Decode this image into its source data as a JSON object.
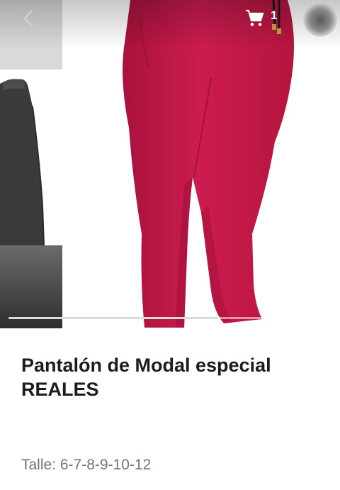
{
  "header": {
    "back_icon": "chevron-left-icon",
    "cart_icon": "shopping-cart-icon",
    "cart_count": "1",
    "avatar_icon": "user-avatar"
  },
  "gallery": {
    "main_color": "#c4194a",
    "slider_progress": 0.65
  },
  "product": {
    "title": "Pantalón de Modal especial REALES",
    "size_line": "Talle: 6-7-8-9-10-12"
  }
}
